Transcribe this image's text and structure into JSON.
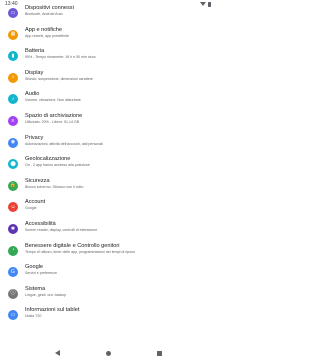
{
  "status_bar": {
    "time": "13:40"
  },
  "items": [
    {
      "title": "Dispositivi connessi",
      "subtitle": "Bluetooth, Android Auto",
      "color": "#6e57d8",
      "icon": "devices-icon"
    },
    {
      "title": "App e notifiche",
      "subtitle": "App recenti, app predefinite",
      "color": "#f29900",
      "icon": "apps-icon"
    },
    {
      "title": "Batteria",
      "subtitle": "95% - Tempo rimanente: 16 h e 50 min circa",
      "color": "#12b5cb",
      "icon": "battery-icon"
    },
    {
      "title": "Display",
      "subtitle": "Sfondo, sospensione, dimensioni carattere",
      "color": "#f29900",
      "icon": "display-icon"
    },
    {
      "title": "Audio",
      "subtitle": "Volume, vibrazione, Non disturbare",
      "color": "#12b5cb",
      "icon": "audio-icon"
    },
    {
      "title": "Spazio di archiviazione",
      "subtitle": "Utilizzato: 20% - Libero: 51,14 GB",
      "color": "#a142f4",
      "icon": "storage-icon"
    },
    {
      "title": "Privacy",
      "subtitle": "Autorizzazioni, attività dell'account, dati personali",
      "color": "#4285f4",
      "icon": "privacy-icon"
    },
    {
      "title": "Geolocalizzazione",
      "subtitle": "On - 2 app hanno accesso alla posizione",
      "color": "#12b5cb",
      "icon": "location-icon"
    },
    {
      "title": "Sicurezza",
      "subtitle": "Blocco schermo, Sblocco con il volto",
      "color": "#34a853",
      "icon": "security-icon"
    },
    {
      "title": "Account",
      "subtitle": "Google",
      "color": "#ea4335",
      "icon": "account-icon"
    },
    {
      "title": "Accessibilità",
      "subtitle": "Screen reader, display, controlli di interazione",
      "color": "#5e35b1",
      "icon": "accessibility-icon"
    },
    {
      "title": "Benessere digitale e Controllo genitori",
      "subtitle": "Tempo di utilizzo, timer delle app, programmazioni dei tempi di riposo",
      "color": "#34a853",
      "icon": "wellbeing-icon"
    },
    {
      "title": "Google",
      "subtitle": "Servizi e preferenze",
      "color": "#4285f4",
      "icon": "google-icon"
    },
    {
      "title": "Sistema",
      "subtitle": "Lingue, gesti, ora, backup",
      "color": "#757575",
      "icon": "system-icon"
    },
    {
      "title": "Informazioni sul tablet",
      "subtitle": "Nokia T20",
      "color": "#4285f4",
      "icon": "info-icon"
    }
  ]
}
